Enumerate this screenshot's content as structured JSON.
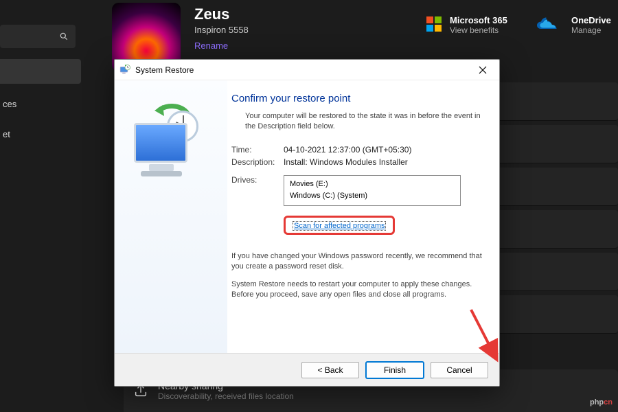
{
  "bg": {
    "user_name": "Zeus",
    "model": "Inspiron 5558",
    "rename": "Rename",
    "side_a_suffix": "ces",
    "side_b_suffix": "et",
    "ms365": "Microsoft 365",
    "ms365_sub": "View benefits",
    "onedrive": "OneDrive",
    "onedrive_sub": "Manage",
    "nearby_title": "Nearby sharing",
    "nearby_sub": "Discoverability, received files location",
    "watermark_a": "php",
    "watermark_b": "cn"
  },
  "dialog": {
    "title": "System Restore",
    "heading": "Confirm your restore point",
    "intro": "Your computer will be restored to the state it was in before the event in the Description field below.",
    "time_label": "Time:",
    "time_value": "04-10-2021 12:37:00 (GMT+05:30)",
    "desc_label": "Description:",
    "desc_value": "Install: Windows Modules Installer",
    "drives_label": "Drives:",
    "drives": [
      "Movies (E:)",
      "Windows (C:) (System)"
    ],
    "scan_link": "Scan for affected programs",
    "note1": "If you have changed your Windows password recently, we recommend that you create a password reset disk.",
    "note2": "System Restore needs to restart your computer to apply these changes. Before you proceed, save any open files and close all programs.",
    "back": "< Back",
    "finish": "Finish",
    "cancel": "Cancel"
  }
}
